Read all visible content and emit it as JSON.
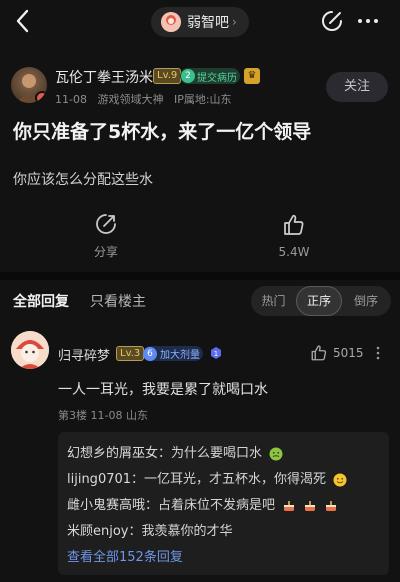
{
  "header": {
    "forum_name": "弱智吧",
    "forum_chevron": "›"
  },
  "author": {
    "name": "瓦伦丁拳王汤米",
    "level": "Lv.9",
    "tag_number": "2",
    "tag_text": "提交病历",
    "date": "11-08",
    "title": "游戏领域大神",
    "ip": "IP属地:山东",
    "follow_label": "关注"
  },
  "post": {
    "title": "你只准备了5杯水，来了一亿个领导",
    "body": "你应该怎么分配这些水",
    "share_label": "分享",
    "like_count": "5.4W"
  },
  "comments_bar": {
    "tab_all": "全部回复",
    "tab_op": "只看楼主",
    "sort_hot": "热门",
    "sort_asc": "正序",
    "sort_desc": "倒序"
  },
  "comment": {
    "user": "归寻碎梦",
    "level": "Lv.3",
    "tag_number": "6",
    "tag_text": "加大剂量",
    "likes": "5015",
    "text": "一人一耳光，我要是累了就喝口水",
    "meta": "第3楼  11-08  山东",
    "replies": [
      {
        "who": "幻想乡的屑巫女",
        "text": "：为什么要喝口水"
      },
      {
        "who": "lijing0701",
        "text": "：一亿耳光，才五杯水，你得渴死"
      },
      {
        "who": "雌小鬼赛高哦",
        "text": "：占着床位不发病是吧"
      },
      {
        "who": "米顾enjoy",
        "text": "：我羡慕你的才华"
      }
    ],
    "view_all": "查看全部152条回复"
  },
  "colors": {
    "background": "#121212",
    "link": "#6f96e8",
    "level_badge": "#e6c66c",
    "tag_green": "#55d4a3"
  }
}
